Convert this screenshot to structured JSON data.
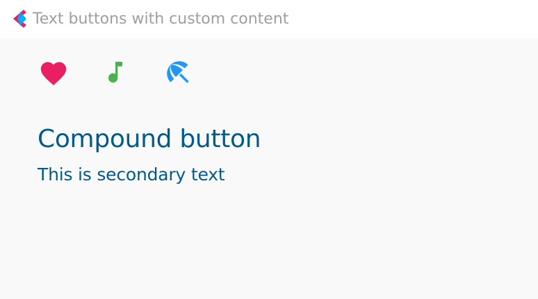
{
  "header": {
    "title": "Text buttons with custom content",
    "logo_icon": "flet-logo-icon",
    "logo_colors": {
      "left": "#e91e63",
      "right": "#03a9f4"
    }
  },
  "icon_buttons": [
    {
      "icon": "favorite-icon",
      "color": "#e91e63"
    },
    {
      "icon": "audiotrack-icon",
      "color": "#4caf50"
    },
    {
      "icon": "beach-access-icon",
      "color": "#2196f3"
    }
  ],
  "compound_button": {
    "primary_text": "Compound button",
    "secondary_text": "This is secondary text",
    "text_color": "#005b8a"
  }
}
